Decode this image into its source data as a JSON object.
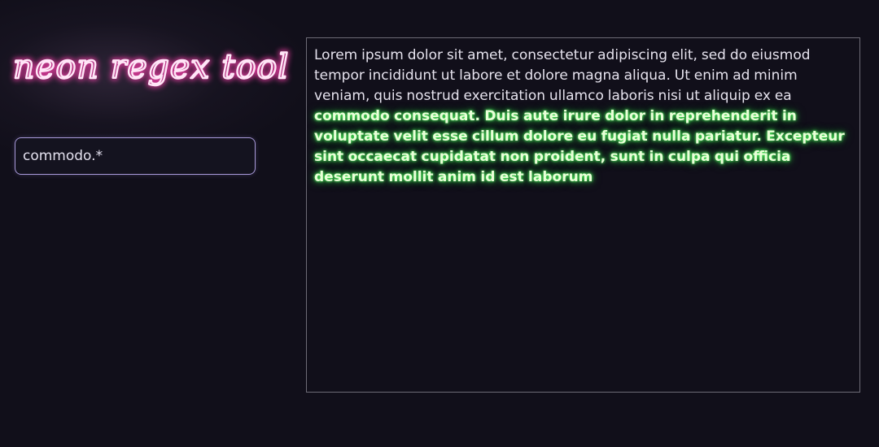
{
  "app": {
    "title": "neon regex tool"
  },
  "search": {
    "value": "commodo.*",
    "placeholder": ""
  },
  "editor": {
    "plain_text": "Lorem ipsum dolor sit amet, consectetur adipiscing elit, sed do eiusmod tempor incididunt ut labore et dolore magna aliqua. Ut enim ad minim veniam, quis nostrud exercitation ullamco laboris nisi ut aliquip ex ea ",
    "matched_text": "commodo consequat. Duis aute irure dolor in reprehenderit in voluptate velit esse cillum dolore eu fugiat nulla pariatur. Excepteur sint occaecat cupidatat non proident, sunt in culpa qui officia deserunt mollit anim id est laborum"
  },
  "colors": {
    "background": "#110f1a",
    "title_glow": "#ff3fae",
    "match_glow": "#2ecc40",
    "input_border": "#a89ad9"
  }
}
